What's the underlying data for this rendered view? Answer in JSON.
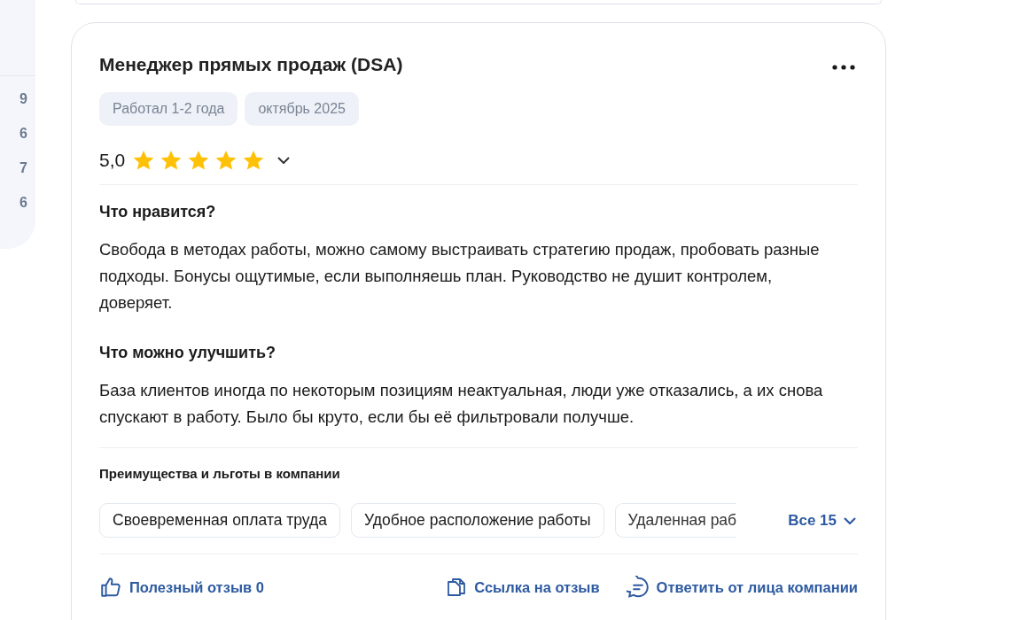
{
  "sidebar": {
    "counts": [
      "9",
      "6",
      "7",
      "6"
    ]
  },
  "review": {
    "title": "Менеджер прямых продаж (DSA)",
    "tags": [
      "Работал 1-2 года",
      "октябрь 2025"
    ],
    "rating": "5,0",
    "stars": 5,
    "sections": [
      {
        "heading": "Что нравится?",
        "text": "Свобода в методах работы, можно самому выстраивать стратегию продаж, пробовать разные подходы. Бонусы ощутимые, если выполняешь план. Руководство не душит контролем, доверяет."
      },
      {
        "heading": "Что можно улучшить?",
        "text": "База клиентов иногда по некоторым позициям неактуальная, люди уже отказались, а их снова спускают в работу. Было бы круто, если бы её фильтровали получше."
      }
    ],
    "benefits_title": "Преимущества и льготы в компании",
    "benefits": [
      "Своевременная оплата труда",
      "Удобное расположение работы",
      "Удаленная раб"
    ],
    "benefits_more": "Все 15",
    "actions": [
      {
        "kind": "like",
        "label": "Полезный отзыв 0"
      },
      {
        "kind": "link",
        "label": "Ссылка на отзыв"
      },
      {
        "kind": "reply",
        "label": "Ответить от лица компании"
      }
    ]
  }
}
